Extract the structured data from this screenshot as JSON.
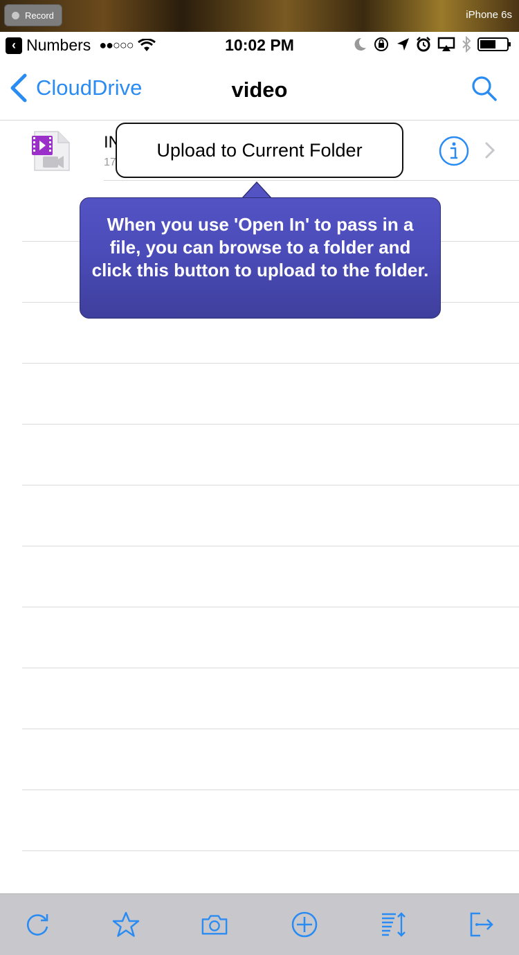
{
  "simulator": {
    "record_label": "Record",
    "device_name": "iPhone 6s"
  },
  "status_bar": {
    "back_app": "Numbers",
    "signal": "●●○○○",
    "time": "10:02 PM"
  },
  "nav": {
    "back_label": "CloudDrive",
    "title": "video"
  },
  "file": {
    "name": "IN",
    "size": "17"
  },
  "callout": {
    "button_label": "Upload to Current Folder"
  },
  "tooltip": {
    "text": "When you use 'Open In' to pass in a file, you can browse to a folder and click this button to upload to the folder."
  },
  "toolbar": {
    "icons": [
      "refresh-icon",
      "star-icon",
      "camera-icon",
      "add-icon",
      "sort-icon",
      "logout-icon"
    ]
  },
  "colors": {
    "accent": "#2a8bf2",
    "tooltip_bg": "#4b4cb9",
    "toolbar_bg": "#c8c8cc",
    "video_icon": "#9b2fc9"
  }
}
